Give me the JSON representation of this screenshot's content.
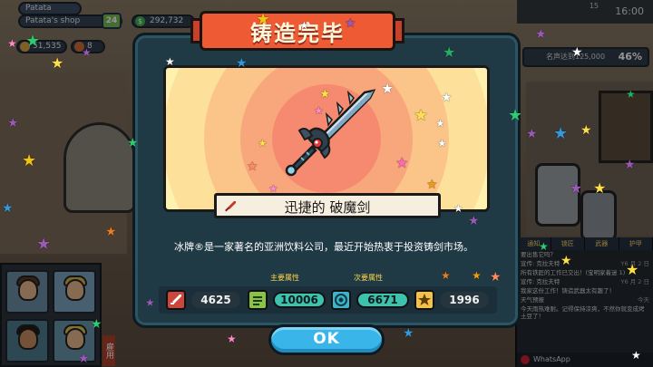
{
  "hud": {
    "player_name": "Patata",
    "shop_name": "Patata's shop",
    "level": "24",
    "money": "292,732",
    "resource_1": "51,535",
    "resource_2": "8",
    "time": "16:00",
    "date": "15"
  },
  "quest": {
    "text": "名声达到125,000",
    "percent": "46%"
  },
  "chat": {
    "tabs": [
      "通知",
      "锁匠",
      "武器",
      "护甲"
    ],
    "lines": [
      {
        "text": "要出售它吗？",
        "time": ""
      },
      {
        "text": "宣传: 克拉夫特",
        "time": "Y6 月 2 日"
      },
      {
        "text": "所有铁匠的工作已交出！(宝明家着迷 1)",
        "time": ""
      },
      {
        "text": "宣传: 克拉夫特",
        "time": "Y6 月 2 日"
      },
      {
        "text": "我家这份工作！铸造武器太有趣了！",
        "time": ""
      },
      {
        "text": "天气预报",
        "time": "今天"
      },
      {
        "text": "今天雨热难耐。记得保持凉爽，不然你就变成烤土豆了！",
        "time": ""
      }
    ],
    "whatsapp_label": "WhatsApp"
  },
  "side_tag": "雇用",
  "modal": {
    "title": "铸造完毕",
    "item_name": "迅捷的 破魔剑",
    "description": "冰牌®是一家著名的亚洲饮料公司，最近开始热衷于投资铸剑市场。",
    "primary_label": "主要属性",
    "secondary_label": "次要属性",
    "stats": [
      {
        "icon": "attack-icon",
        "value": "4625"
      },
      {
        "icon": "speed-icon",
        "value": "10006"
      },
      {
        "icon": "accuracy-icon",
        "value": "6671"
      },
      {
        "icon": "luck-icon",
        "value": "1996"
      }
    ],
    "ok_label": "OK"
  },
  "colors": {
    "modal_bg": "#1f3a45",
    "banner": "#ee5a34",
    "ok_button": "#3ab5ea",
    "stat_highlight": "#3cc2ad"
  }
}
